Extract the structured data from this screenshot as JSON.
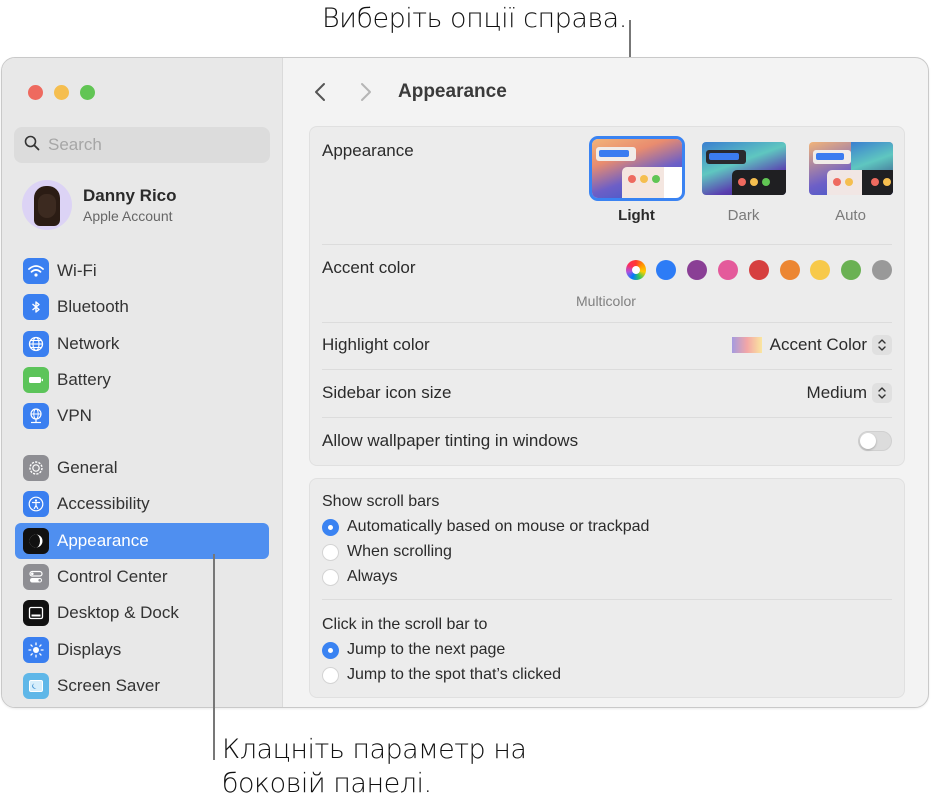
{
  "callouts": {
    "top": "Виберіть опції справа.",
    "bottom_line1": "Клацніть параметр на",
    "bottom_line2": "боковій панелі."
  },
  "window": {
    "traffic_lights": [
      "close",
      "minimize",
      "zoom"
    ]
  },
  "sidebar": {
    "search_placeholder": "Search",
    "account": {
      "name": "Danny Rico",
      "subtitle": "Apple Account"
    },
    "group1": [
      {
        "label": "Wi-Fi",
        "icon": "wifi-icon",
        "color": "#3a7ff0"
      },
      {
        "label": "Bluetooth",
        "icon": "bluetooth-icon",
        "color": "#3a7ff0"
      },
      {
        "label": "Network",
        "icon": "globe-icon",
        "color": "#3a7ff0"
      },
      {
        "label": "Battery",
        "icon": "battery-icon",
        "color": "#5cc45a"
      },
      {
        "label": "VPN",
        "icon": "vpn-globe-icon",
        "color": "#3a7ff0"
      }
    ],
    "group2": [
      {
        "label": "General",
        "icon": "gear-icon",
        "color": "#8e8e93"
      },
      {
        "label": "Accessibility",
        "icon": "accessibility-icon",
        "color": "#3a7ff0"
      },
      {
        "label": "Appearance",
        "icon": "appearance-icon",
        "color": "#111111",
        "selected": true
      },
      {
        "label": "Control Center",
        "icon": "control-center-icon",
        "color": "#8e8e93"
      },
      {
        "label": "Desktop & Dock",
        "icon": "dock-icon",
        "color": "#111111"
      },
      {
        "label": "Displays",
        "icon": "sun-icon",
        "color": "#3a7ff0"
      },
      {
        "label": "Screen Saver",
        "icon": "screen-saver-icon",
        "color": "#5fb7e8"
      }
    ]
  },
  "main": {
    "title": "Appearance",
    "appearance": {
      "label": "Appearance",
      "options": [
        {
          "label": "Light",
          "selected": true
        },
        {
          "label": "Dark",
          "selected": false
        },
        {
          "label": "Auto",
          "selected": false
        }
      ]
    },
    "accent": {
      "label": "Accent color",
      "selected_caption": "Multicolor",
      "colors": [
        {
          "name": "multicolor",
          "hex": "multicolor"
        },
        {
          "name": "blue",
          "hex": "#2d7cf6"
        },
        {
          "name": "purple",
          "hex": "#8a3f95"
        },
        {
          "name": "pink",
          "hex": "#e45a9b"
        },
        {
          "name": "red",
          "hex": "#d63f3f"
        },
        {
          "name": "orange",
          "hex": "#ec8632"
        },
        {
          "name": "yellow",
          "hex": "#f7c94a"
        },
        {
          "name": "green",
          "hex": "#6ab153"
        },
        {
          "name": "graphite",
          "hex": "#999999"
        }
      ]
    },
    "highlight": {
      "label": "Highlight color",
      "value": "Accent Color"
    },
    "sidebar_icon_size": {
      "label": "Sidebar icon size",
      "value": "Medium"
    },
    "wallpaper_tinting": {
      "label": "Allow wallpaper tinting in windows",
      "enabled": false
    },
    "scroll_bars": {
      "label": "Show scroll bars",
      "options": [
        {
          "label": "Automatically based on mouse or trackpad",
          "selected": true
        },
        {
          "label": "When scrolling",
          "selected": false
        },
        {
          "label": "Always",
          "selected": false
        }
      ]
    },
    "click_scroll": {
      "label": "Click in the scroll bar to",
      "options": [
        {
          "label": "Jump to the next page",
          "selected": true
        },
        {
          "label": "Jump to the spot that’s clicked",
          "selected": false
        }
      ]
    }
  }
}
